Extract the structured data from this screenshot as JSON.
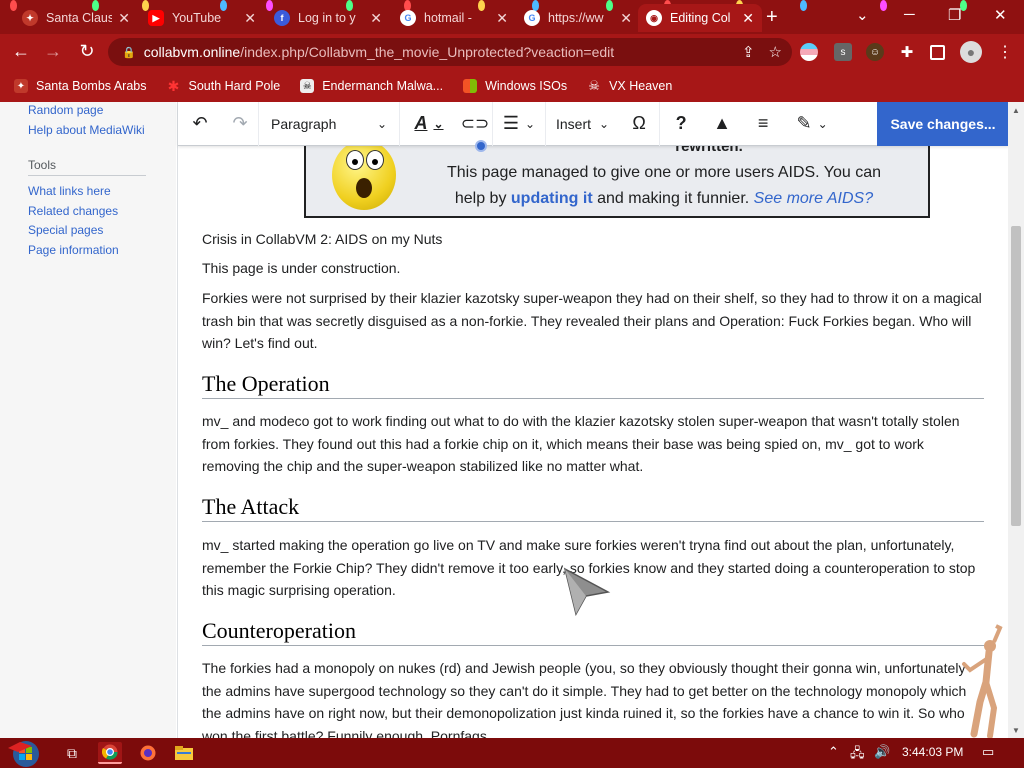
{
  "tabs": [
    {
      "title": "Santa Claus",
      "favicon": "santa-icon",
      "color": "#c0392b"
    },
    {
      "title": "YouTube",
      "favicon": "youtube-icon",
      "color": "#ff0000"
    },
    {
      "title": "Log in to y",
      "favicon": "firefox-icon",
      "color": "#3b5bdb"
    },
    {
      "title": "hotmail -",
      "favicon": "google-icon",
      "color": "#4285f4"
    },
    {
      "title": "https://ww",
      "favicon": "google-icon",
      "color": "#4285f4"
    },
    {
      "title": "Editing Col",
      "favicon": "globe-icon",
      "color": "#ffffff",
      "active": true
    }
  ],
  "address_bar": {
    "host": "collabvm.online",
    "path": "/index.php/Collabvm_the_movie_Unprotected?veaction=edit"
  },
  "bookmarks": [
    {
      "label": "Santa Bombs Arabs",
      "icon": "santa-icon"
    },
    {
      "label": "South Hard Pole",
      "icon": "snowflake-icon"
    },
    {
      "label": "Endermanch Malwa...",
      "icon": "skull-icon"
    },
    {
      "label": "Windows ISOs",
      "icon": "windows-icon"
    },
    {
      "label": "VX Heaven",
      "icon": "skull-icon"
    }
  ],
  "sidebar": {
    "top_links": [
      "Random page",
      "Help about MediaWiki"
    ],
    "tools_heading": "Tools",
    "tools_links": [
      "What links here",
      "Related changes",
      "Special pages",
      "Page information"
    ]
  },
  "ve_toolbar": {
    "format": "Paragraph",
    "insert": "Insert",
    "save": "Save changes..."
  },
  "notice": {
    "line1": "rewritten.",
    "line2": "This page managed to give one or more users AIDS. You can",
    "line3_a": "help by ",
    "line3_link": "updating it",
    "line3_b": " and making it funnier. ",
    "line3_italic": "See more AIDS?"
  },
  "article": {
    "p1": "Crisis in CollabVM 2: AIDS on my Nuts",
    "p2": "This page is under construction.",
    "p3": "Forkies were not surprised by their klazier kazotsky super-weapon they had on their shelf, so they had to throw it on a magical trash bin that was secretly disguised as a non-forkie. They revealed their plans and Operation: Fuck Forkies began. Who will win? Let's find out.",
    "h_operation": "The Operation",
    "p4": "mv_ and modeco got to work finding out what to do with the klazier kazotsky stolen super-weapon that wasn't totally stolen from forkies. They found out this had a forkie chip on it, which means their base was being spied on, mv_ got to work removing the chip and the super-weapon stabilized like no matter what.",
    "h_attack": "The Attack",
    "p5": "mv_ started making the operation go live on TV and make sure forkies weren't tryna find out about the plan, unfortunately, remember the Forkie Chip? They didn't remove it too early, so forkies know and they started doing a counteroperation to stop this magic surprising operation.",
    "h_counter": "Counteroperation",
    "p6": "The forkies had a monopoly on nukes (rd) and Jewish people (you, so they obviously thought their gonna win, unfortunately the admins have supergood technology so they can't do it simple. They had to get better on the technology monopoly which the admins have on right now, but their demonopolization just kinda ruined it, so the forkies have a chance to win it. So who won the first battle? Funnily enough, Pornfags."
  },
  "taskbar": {
    "clock": "3:44:03 PM"
  },
  "colors": {
    "chrome_frame": "#a71717",
    "tab_strip": "#8f1111",
    "accent_blue": "#3366cc",
    "taskbar": "#7c0b0b"
  }
}
